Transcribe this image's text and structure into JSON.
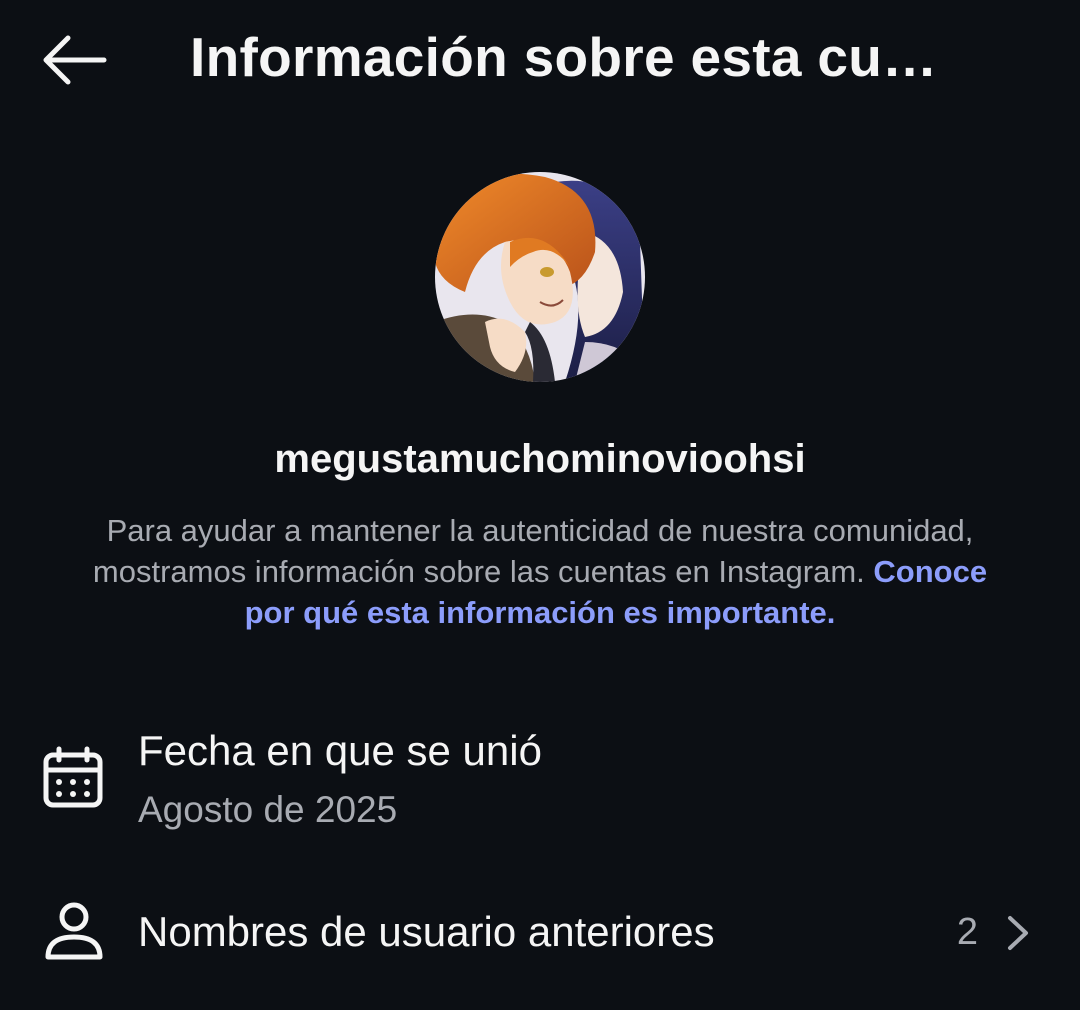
{
  "header": {
    "title": "Información sobre esta cu…",
    "back_icon": "arrow-left-icon"
  },
  "profile": {
    "avatar": "anime-illustration-avatar",
    "username": "megustamuchominovioohsi"
  },
  "description": {
    "text": "Para ayudar a mantener la autenticidad de nuestra comunidad, mostramos información sobre las cuentas en Instagram.",
    "link_text": "Conoce por qué esta información es importante.",
    "link_color": "#8c9dfb"
  },
  "joined": {
    "icon": "calendar-icon",
    "label": "Fecha en que se unió",
    "value": "Agosto de 2025"
  },
  "previous_usernames": {
    "icon": "user-icon",
    "label": "Nombres de usuario anteriores",
    "count": "2",
    "chevron_icon": "chevron-right-icon"
  },
  "colors": {
    "background": "#0c0f14",
    "text_primary": "#f5f5f5",
    "text_secondary": "#a8abb2"
  }
}
